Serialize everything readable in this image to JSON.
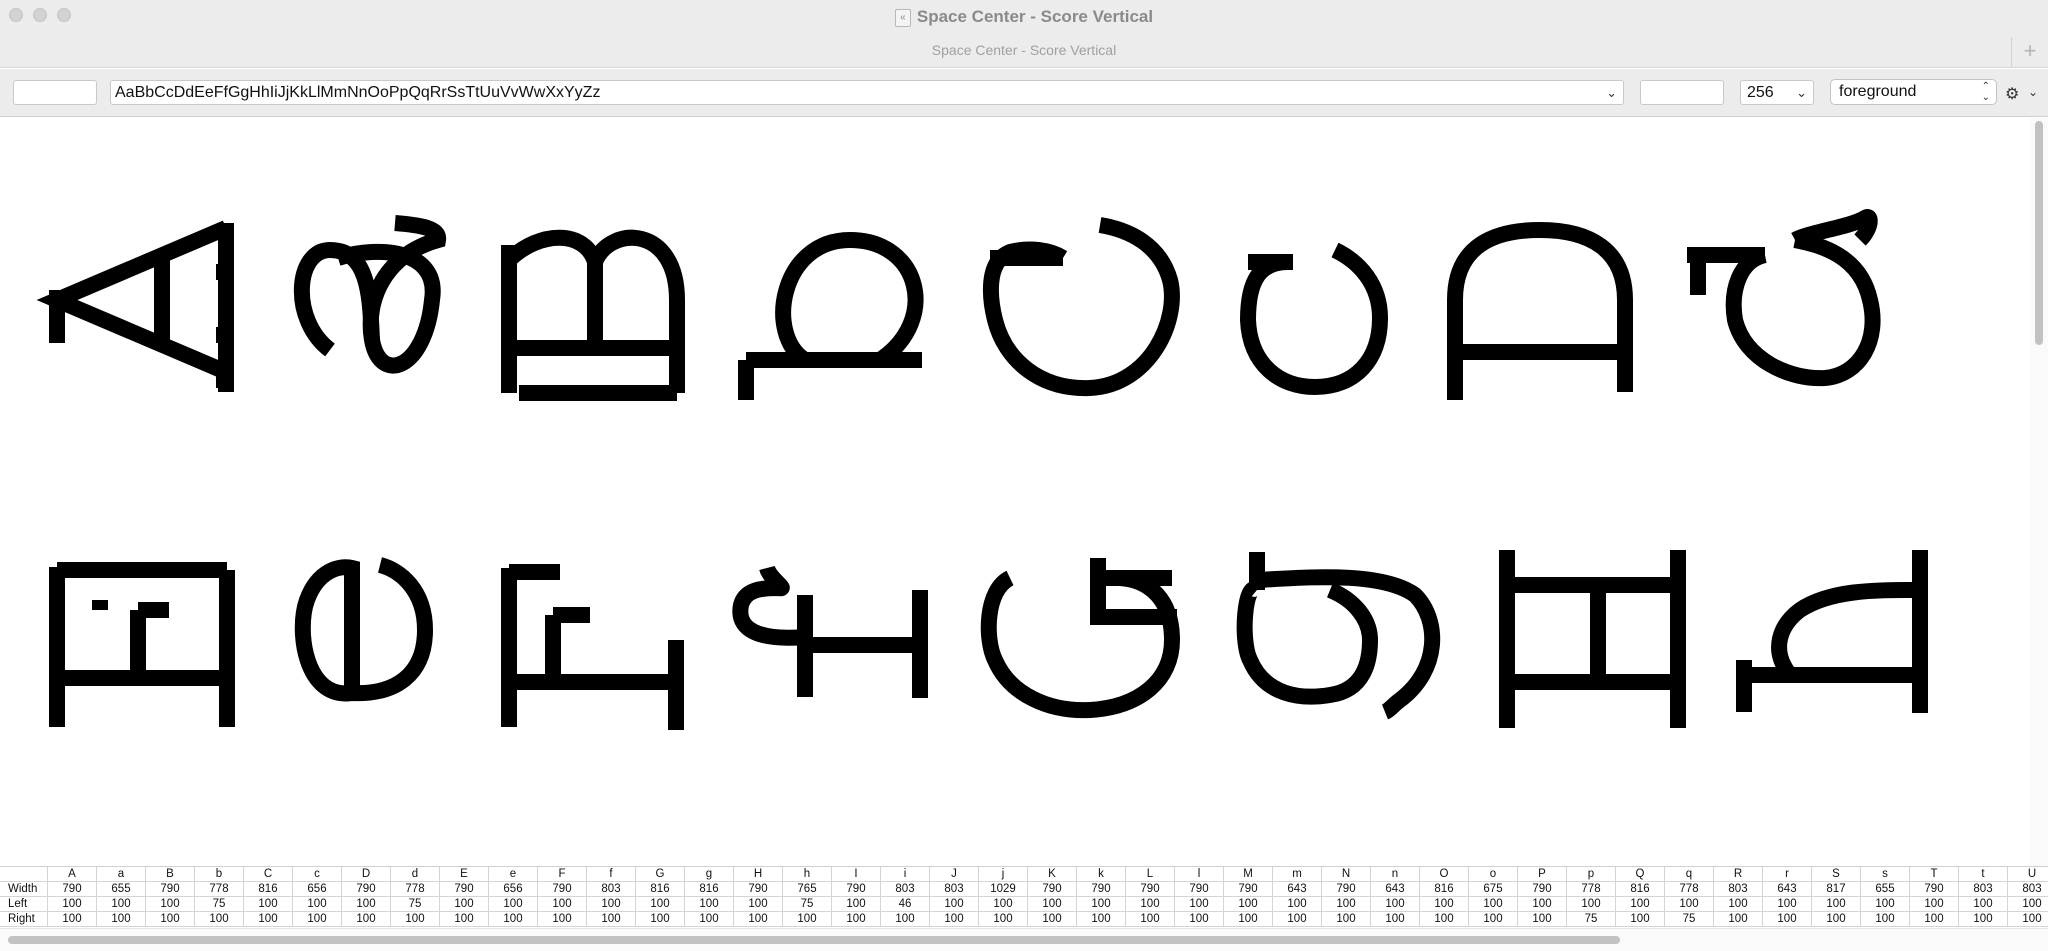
{
  "window": {
    "title": "Space Center - Score Vertical",
    "tab_title": "Space Center - Score Vertical",
    "new_tab_label": "+"
  },
  "toolbar": {
    "before_field": "",
    "text_field": "AaBbCcDdEeFfGgHhIiJjKkLlMmNnOoPpQqRrSsTtUuVvWwXxYyZz",
    "after_field": "",
    "size_value": "256",
    "layer_value": "foreground"
  },
  "icons": {
    "doc": "document-icon",
    "text_dropdown": "chevron-down-icon",
    "size_dropdown": "chevron-down-icon",
    "layer_popup": "up-down-chevron-icon",
    "settings": "gear-icon"
  },
  "colors": {
    "glyph_fill": "#000000",
    "chrome": "#ececec",
    "scroll_thumb": "#c1c1c1"
  },
  "table": {
    "row_labels": [
      "Width",
      "Left",
      "Right"
    ],
    "columns": [
      {
        "glyph": "A",
        "width": "790",
        "left": "100",
        "right": "100"
      },
      {
        "glyph": "a",
        "width": "655",
        "left": "100",
        "right": "100"
      },
      {
        "glyph": "B",
        "width": "790",
        "left": "100",
        "right": "100"
      },
      {
        "glyph": "b",
        "width": "778",
        "left": "75",
        "right": "100"
      },
      {
        "glyph": "C",
        "width": "816",
        "left": "100",
        "right": "100"
      },
      {
        "glyph": "c",
        "width": "656",
        "left": "100",
        "right": "100"
      },
      {
        "glyph": "D",
        "width": "790",
        "left": "100",
        "right": "100"
      },
      {
        "glyph": "d",
        "width": "778",
        "left": "75",
        "right": "100"
      },
      {
        "glyph": "E",
        "width": "790",
        "left": "100",
        "right": "100"
      },
      {
        "glyph": "e",
        "width": "656",
        "left": "100",
        "right": "100"
      },
      {
        "glyph": "F",
        "width": "790",
        "left": "100",
        "right": "100"
      },
      {
        "glyph": "f",
        "width": "803",
        "left": "100",
        "right": "100"
      },
      {
        "glyph": "G",
        "width": "816",
        "left": "100",
        "right": "100"
      },
      {
        "glyph": "g",
        "width": "816",
        "left": "100",
        "right": "100"
      },
      {
        "glyph": "H",
        "width": "790",
        "left": "100",
        "right": "100"
      },
      {
        "glyph": "h",
        "width": "765",
        "left": "75",
        "right": "100"
      },
      {
        "glyph": "I",
        "width": "790",
        "left": "100",
        "right": "100"
      },
      {
        "glyph": "i",
        "width": "803",
        "left": "46",
        "right": "100"
      },
      {
        "glyph": "J",
        "width": "803",
        "left": "100",
        "right": "100"
      },
      {
        "glyph": "j",
        "width": "1029",
        "left": "100",
        "right": "100"
      },
      {
        "glyph": "K",
        "width": "790",
        "left": "100",
        "right": "100"
      },
      {
        "glyph": "k",
        "width": "790",
        "left": "100",
        "right": "100"
      },
      {
        "glyph": "L",
        "width": "790",
        "left": "100",
        "right": "100"
      },
      {
        "glyph": "l",
        "width": "790",
        "left": "100",
        "right": "100"
      },
      {
        "glyph": "M",
        "width": "790",
        "left": "100",
        "right": "100"
      },
      {
        "glyph": "m",
        "width": "643",
        "left": "100",
        "right": "100"
      },
      {
        "glyph": "N",
        "width": "790",
        "left": "100",
        "right": "100"
      },
      {
        "glyph": "n",
        "width": "643",
        "left": "100",
        "right": "100"
      },
      {
        "glyph": "O",
        "width": "816",
        "left": "100",
        "right": "100"
      },
      {
        "glyph": "o",
        "width": "675",
        "left": "100",
        "right": "100"
      },
      {
        "glyph": "P",
        "width": "790",
        "left": "100",
        "right": "100"
      },
      {
        "glyph": "p",
        "width": "778",
        "left": "100",
        "right": "75"
      },
      {
        "glyph": "Q",
        "width": "816",
        "left": "100",
        "right": "100"
      },
      {
        "glyph": "q",
        "width": "778",
        "left": "100",
        "right": "75"
      },
      {
        "glyph": "R",
        "width": "803",
        "left": "100",
        "right": "100"
      },
      {
        "glyph": "r",
        "width": "643",
        "left": "100",
        "right": "100"
      },
      {
        "glyph": "S",
        "width": "817",
        "left": "100",
        "right": "100"
      },
      {
        "glyph": "s",
        "width": "655",
        "left": "100",
        "right": "100"
      },
      {
        "glyph": "T",
        "width": "790",
        "left": "100",
        "right": "100"
      },
      {
        "glyph": "t",
        "width": "803",
        "left": "100",
        "right": "100"
      },
      {
        "glyph": "U",
        "width": "803",
        "left": "100",
        "right": "100"
      }
    ]
  }
}
